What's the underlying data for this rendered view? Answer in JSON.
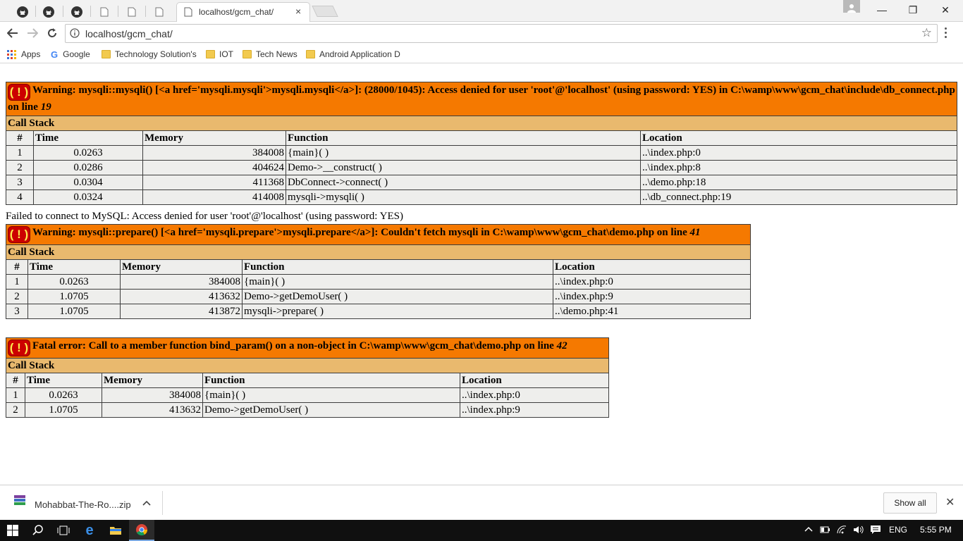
{
  "browser": {
    "active_tab_title": "localhost/gcm_chat/",
    "close_tab_glyph": "×",
    "url": "localhost/gcm_chat/",
    "window_controls": {
      "minimize": "—",
      "restore": "❐",
      "close": "✕"
    }
  },
  "bookmarks": [
    {
      "label": "Apps",
      "icon": "apps-icon"
    },
    {
      "label": "Google",
      "icon": "google-icon"
    },
    {
      "label": "Technology Solution's",
      "icon": "folder-icon"
    },
    {
      "label": "IOT",
      "icon": "folder-icon"
    },
    {
      "label": "Tech News",
      "icon": "folder-icon"
    },
    {
      "label": "Android Application D",
      "icon": "folder-icon"
    }
  ],
  "errors": {
    "e1": {
      "icon": "( ! )",
      "message": "Warning: mysqli::mysqli() [<a href='mysqli.mysqli'>mysqli.mysqli</a>]: (28000/1045): Access denied for user 'root'@'localhost' (using password: YES) in C:\\wamp\\www\\gcm_chat\\include\\db_connect.php on line ",
      "line": "19",
      "call_stack": "Call Stack",
      "cols": [
        "#",
        "Time",
        "Memory",
        "Function",
        "Location"
      ],
      "rows": [
        [
          "1",
          "0.0263",
          "384008",
          "{main}( )",
          "..\\index.php:0"
        ],
        [
          "2",
          "0.0286",
          "404624",
          "Demo->__construct( )",
          "..\\index.php:8"
        ],
        [
          "3",
          "0.0304",
          "411368",
          "DbConnect->connect( )",
          "..\\demo.php:18"
        ],
        [
          "4",
          "0.0324",
          "414008",
          "mysqli->mysqli( )",
          "..\\db_connect.php:19"
        ]
      ]
    },
    "failed_message": "Failed to connect to MySQL: Access denied for user 'root'@'localhost' (using password: YES)",
    "e2": {
      "icon": "( ! )",
      "message": "Warning: mysqli::prepare() [<a href='mysqli.prepare'>mysqli.prepare</a>]: Couldn't fetch mysqli in C:\\wamp\\www\\gcm_chat\\demo.php on line ",
      "line": "41",
      "call_stack": "Call Stack",
      "cols": [
        "#",
        "Time",
        "Memory",
        "Function",
        "Location"
      ],
      "rows": [
        [
          "1",
          "0.0263",
          "384008",
          "{main}( )",
          "..\\index.php:0"
        ],
        [
          "2",
          "1.0705",
          "413632",
          "Demo->getDemoUser( )",
          "..\\index.php:9"
        ],
        [
          "3",
          "1.0705",
          "413872",
          "mysqli->prepare( )",
          "..\\demo.php:41"
        ]
      ]
    },
    "e3": {
      "icon": "( ! )",
      "message": "Fatal error: Call to a member function bind_param() on a non-object in C:\\wamp\\www\\gcm_chat\\demo.php on line ",
      "line": "42",
      "call_stack": "Call Stack",
      "cols": [
        "#",
        "Time",
        "Memory",
        "Function",
        "Location"
      ],
      "rows": [
        [
          "1",
          "0.0263",
          "384008",
          "{main}( )",
          "..\\index.php:0"
        ],
        [
          "2",
          "1.0705",
          "413632",
          "Demo->getDemoUser( )",
          "..\\index.php:9"
        ]
      ]
    }
  },
  "download_shelf": {
    "file_name": "Mohabbat-The-Ro....zip",
    "show_all": "Show all",
    "chevron": "^",
    "close": "✕"
  },
  "taskbar": {
    "language": "ENG",
    "time": "5:55 PM"
  },
  "colors": {
    "error_header": "#f57900",
    "call_stack_bg": "#e9b96e",
    "cell_bg": "#eeeeec",
    "error_icon_bg": "#cc0000",
    "error_icon_fg": "#fce94f"
  }
}
